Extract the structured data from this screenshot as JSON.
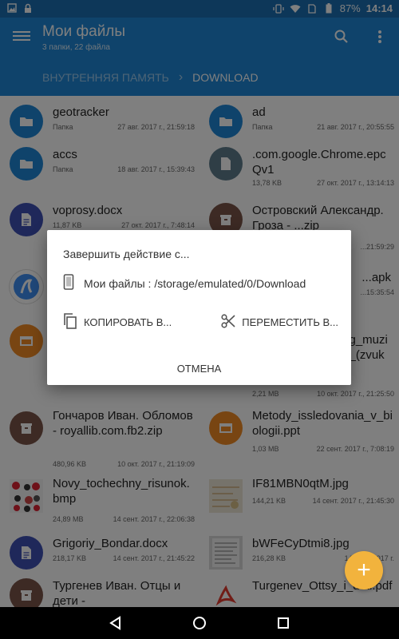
{
  "status_bar": {
    "battery": "87%",
    "time": "14:14",
    "icons": [
      "image-icon",
      "lock-icon",
      "vibrate-icon",
      "wifi-icon",
      "sim-off-icon",
      "battery-icon"
    ]
  },
  "app_bar": {
    "title": "Мои файлы",
    "subtitle": "3 папки, 22 файла",
    "breadcrumb": [
      "ВНУТРЕННЯЯ ПАМЯТЬ",
      "DOWNLOAD"
    ],
    "crumb_sep": "›"
  },
  "files": [
    {
      "name": "geotracker",
      "size": "Папка",
      "date": "27 авг. 2017 г., 21:59:18",
      "icon": "folder-icon",
      "color": "#1f87d6"
    },
    {
      "name": "ad",
      "size": "Папка",
      "date": "21 авг. 2017 г., 20:55:55",
      "icon": "folder-icon",
      "color": "#1f87d6"
    },
    {
      "name": "accs",
      "size": "Папка",
      "date": "18 авг. 2017 г., 15:39:43",
      "icon": "folder-icon",
      "color": "#1f87d6"
    },
    {
      "name": ".com.google.Chrome.epcQv1",
      "size": "13,78 KB",
      "date": "27 окт. 2017 г., 13:14:13",
      "icon": "file-icon",
      "color": "#5f7d8c"
    },
    {
      "name": "voprosy.docx",
      "size": "11,87 KB",
      "date": "27 окт. 2017 г., 7:48:14",
      "icon": "document-icon",
      "color": "#3f51b5"
    },
    {
      "name": "Островский Александр. Гроза - ...zip",
      "size": "",
      "date": "...21:59:29",
      "icon": "archive-icon",
      "color": "#7a5548"
    },
    {
      "name": "",
      "size": "",
      "date": "",
      "icon": "app-icon",
      "color": "#3f8ef2"
    },
    {
      "name": "...apk",
      "size": "",
      "date": "...15:35:54",
      "icon": "",
      "color": ""
    },
    {
      "name": "",
      "size": "",
      "date": "",
      "icon": "presentation-icon",
      "color": "#f08a24"
    },
    {
      "name": "...g_muzi ..._(zvuk",
      "size": "2,21 MB",
      "date": "10 окт. 2017 г., 21:25:50",
      "icon": "",
      "color": ""
    },
    {
      "name": "Гончаров Иван. Обломов - royallib.com.fb2.zip",
      "size": "480,96 KB",
      "date": "10 окт. 2017 г., 21:19:09",
      "icon": "archive-icon",
      "color": "#7a5548"
    },
    {
      "name": "Metody_issledovania_v_biologii.ppt",
      "size": "1,03 MB",
      "date": "22 сент. 2017 г., 7:08:19",
      "icon": "presentation-icon",
      "color": "#f08a24"
    },
    {
      "name": "Novy_tochechny_risunok.bmp",
      "size": "24,89 MB",
      "date": "14 сент. 2017 г., 22:06:38",
      "icon": "image-thumb",
      "color": "#d23"
    },
    {
      "name": "IF81MBN0qtM.jpg",
      "size": "144,21 KB",
      "date": "14 сент. 2017 г., 21:45:30",
      "icon": "image-thumb",
      "color": "#c9b98a"
    },
    {
      "name": "Grigoriy_Bondar.docx",
      "size": "218,17 KB",
      "date": "14 сент. 2017 г., 21:45:22",
      "icon": "document-icon",
      "color": "#3f51b5"
    },
    {
      "name": "bWFeCyDtmi8.jpg",
      "size": "216,28 KB",
      "date": "14 сент. 2017 г.",
      "icon": "image-thumb",
      "color": "#aaa"
    },
    {
      "name": "Тургенев Иван. Отцы и дети -",
      "size": "",
      "date": "",
      "icon": "archive-icon",
      "color": "#7a5548"
    },
    {
      "name": "Turgenev_Ottsy_i_deti.pdf",
      "size": "",
      "date": "",
      "icon": "pdf-icon",
      "color": "#e23b2e"
    }
  ],
  "dialog": {
    "title": "Завершить действие с...",
    "app_path": "Мои файлы : /storage/emulated/0/Download",
    "copy_label": "КОПИРОВАТЬ В...",
    "move_label": "ПЕРЕМЕСТИТЬ В...",
    "cancel_label": "ОТМЕНА"
  },
  "fab_label": "+"
}
